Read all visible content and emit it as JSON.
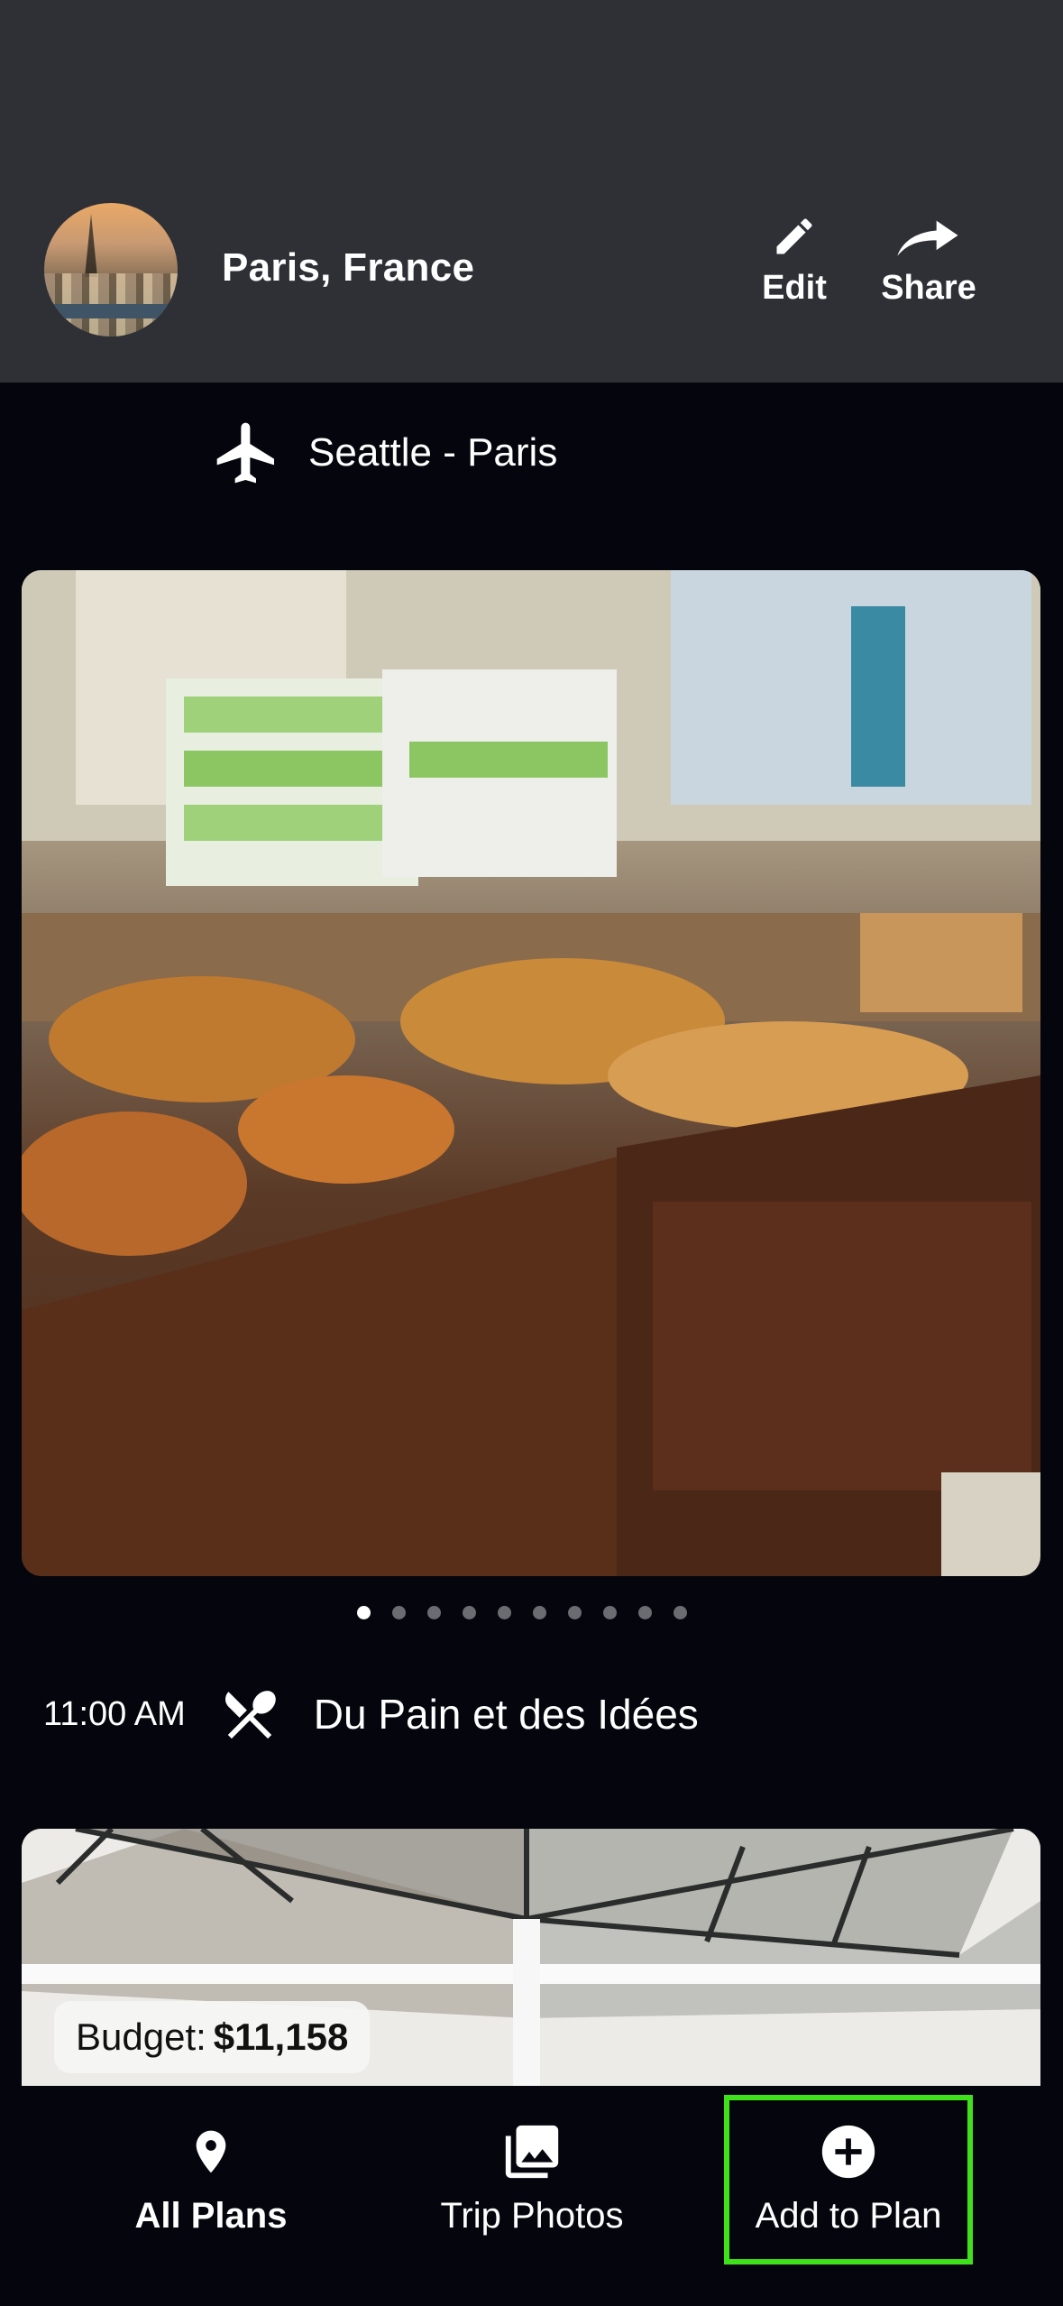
{
  "header": {
    "title": "Paris, France",
    "edit_label": "Edit",
    "share_label": "Share"
  },
  "flight": {
    "route": "Seattle - Paris"
  },
  "gallery": {
    "page_count": 10,
    "active_index": 0
  },
  "itinerary": [
    {
      "time": "11:00 AM",
      "place": "Du Pain et des Idées"
    }
  ],
  "budget": {
    "label": "Budget:",
    "amount": "$11,158"
  },
  "bottom_nav": {
    "all_plans": "All Plans",
    "trip_photos": "Trip Photos",
    "add_to_plan": "Add to Plan"
  },
  "colors": {
    "background": "#05060d",
    "header_bg": "#2f3035",
    "highlight": "#3fe21a"
  }
}
